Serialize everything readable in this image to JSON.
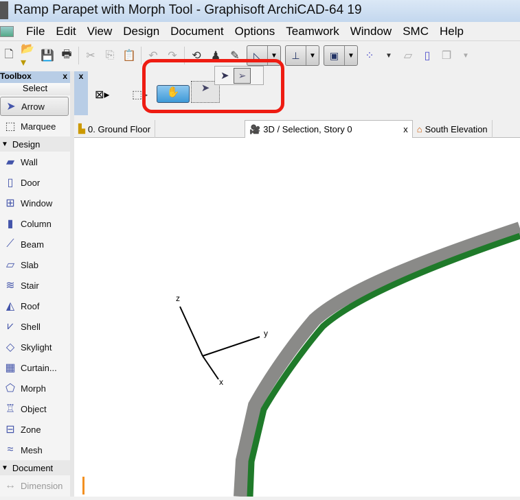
{
  "window": {
    "title": "Ramp Parapet with Morph Tool - Graphisoft ArchiCAD-64 19"
  },
  "menu": [
    "File",
    "Edit",
    "View",
    "Design",
    "Document",
    "Options",
    "Teamwork",
    "Window",
    "SMC",
    "Help"
  ],
  "toolbox": {
    "title": "Toolbox",
    "close": "x",
    "select_label": "Select",
    "select_tools": [
      {
        "label": "Arrow",
        "icon": "arrow-icon"
      },
      {
        "label": "Marquee",
        "icon": "marquee-icon"
      }
    ],
    "design_label": "Design",
    "design_tools": [
      {
        "label": "Wall"
      },
      {
        "label": "Door"
      },
      {
        "label": "Window"
      },
      {
        "label": "Column"
      },
      {
        "label": "Beam"
      },
      {
        "label": "Slab"
      },
      {
        "label": "Stair"
      },
      {
        "label": "Roof"
      },
      {
        "label": "Shell"
      },
      {
        "label": "Skylight"
      },
      {
        "label": "Curtain..."
      },
      {
        "label": "Morph"
      },
      {
        "label": "Object"
      },
      {
        "label": "Zone"
      },
      {
        "label": "Mesh"
      }
    ],
    "document_label": "Document",
    "document_tools": [
      {
        "label": "Dimension"
      }
    ]
  },
  "infobox": {
    "close": "x"
  },
  "tabs": [
    {
      "label": "0. Ground Floor"
    },
    {
      "label": "3D / Selection, Story 0",
      "close": "x",
      "active": true
    },
    {
      "label": "South Elevation"
    }
  ],
  "viewport": {
    "axes": {
      "x": "x",
      "y": "y",
      "z": "z"
    }
  },
  "colors": {
    "highlight": "#ee1c12",
    "parapet_gray": "#8a8a88",
    "parapet_green": "#1f7a2a"
  }
}
